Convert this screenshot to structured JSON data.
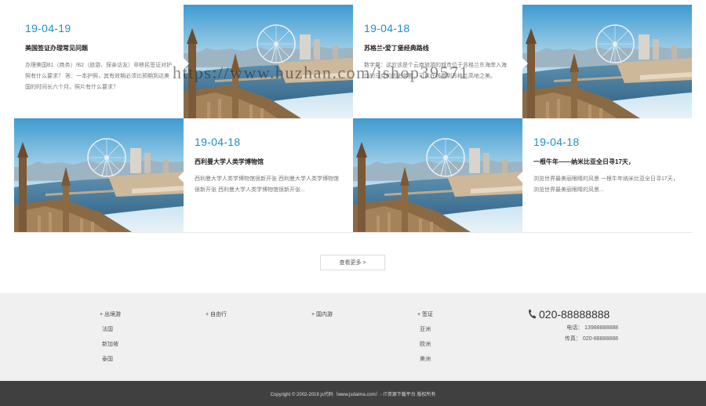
{
  "news": {
    "items": [
      {
        "date": "19-04-19",
        "title": "美国签证办理常见问题",
        "summary": "办理美国B1（商务）/B2（旅游、探亲访友）非移民签证对护照有什么要求？ 答：一本护照，其有效期必须比预期到达美国的时间长六个月，照片有什么要求？"
      },
      {
        "date": "19-04-18",
        "title": "苏格兰•爱丁堡经典路线",
        "summary": "数字量：这应该是个云南旅游的城市位于苏格兰东海岸入海口的马克的历史名胜，可以在线看到苏格兰高地之美。"
      },
      {
        "date": "19-04-18",
        "title": "西利曼大学人类学博物馆",
        "summary": "西利曼大学人类学博物馆很新开张 西利曼大学人类学博物馆很新开张 西利曼大学人类学博物馆很新开张..."
      },
      {
        "date": "19-04-18",
        "title": "一根牛年——纳米比亚全日寻17天，",
        "summary": "浏览世界最美丽眼睛的风景 一根牛年纳米比亚全日寻17天，浏览世界最美丽眼睛的风景..."
      }
    ],
    "photo_alt": "London Eye river panorama"
  },
  "more_button": {
    "label": "查看更多 >"
  },
  "footer": {
    "columns": [
      {
        "head": "+ 出境游",
        "links": [
          "法国",
          "新加坡",
          "泰国"
        ]
      },
      {
        "head": "+ 自由行",
        "links": []
      },
      {
        "head": "+ 国内游",
        "links": []
      },
      {
        "head": "+ 签证",
        "links": [
          "亚洲",
          "欧洲",
          "美洲"
        ]
      }
    ],
    "contact": {
      "phone": "020-88888888",
      "mobile": "电话：  13988888888",
      "fax": "传真：  020-88888888"
    },
    "copyright": "Copyright © 2002-2019 js代码（www.jsdaima.com）- IT资源下载平台 版权所有"
  },
  "watermark": "https://www.huzhan.com/ishop39571"
}
